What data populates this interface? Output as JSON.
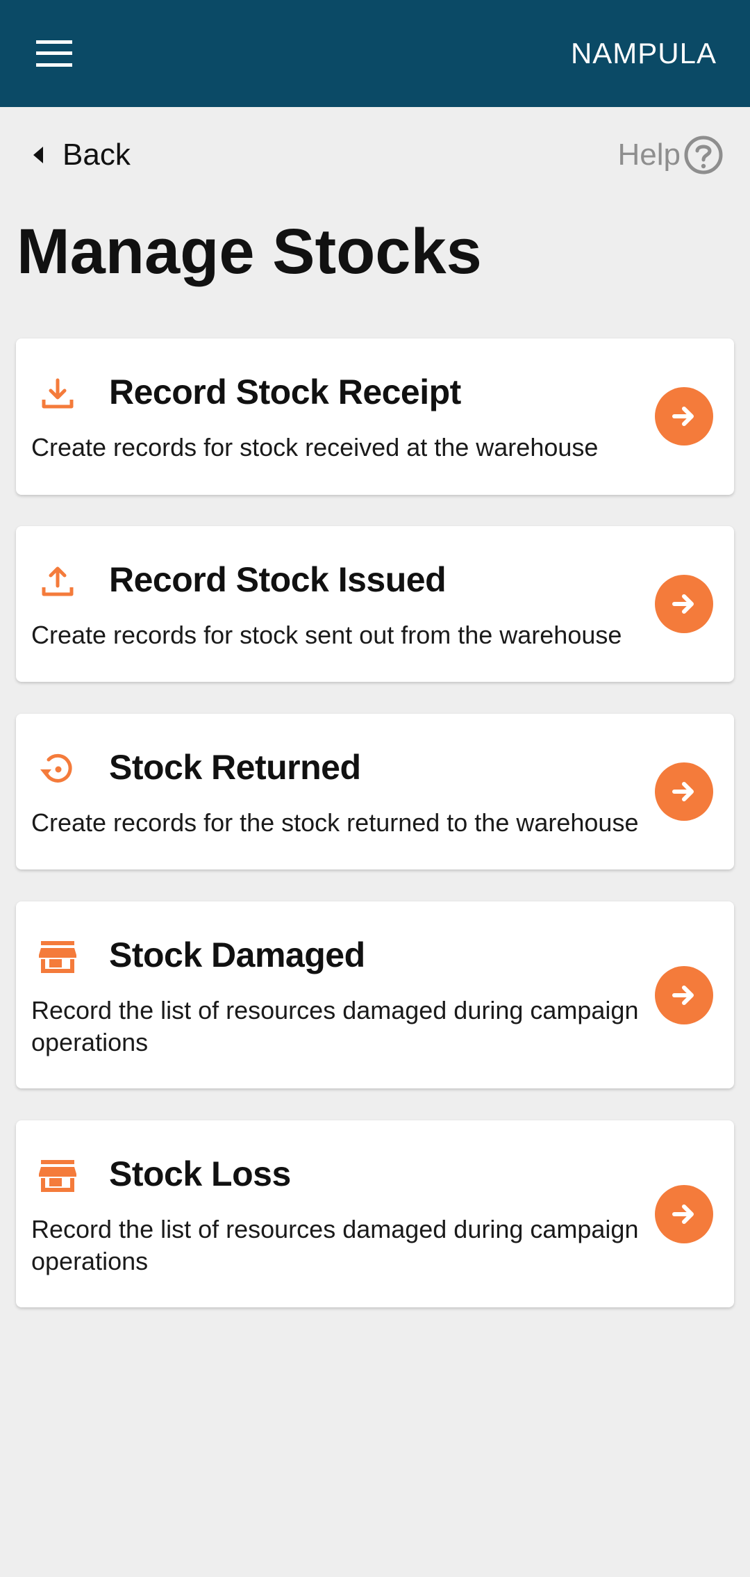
{
  "header": {
    "location": "NAMPULA",
    "menu_icon": "hamburger-menu-icon"
  },
  "nav": {
    "back_label": "Back",
    "help_label": "Help"
  },
  "page": {
    "title": "Manage Stocks"
  },
  "colors": {
    "header_bg": "#0b4a66",
    "accent": "#f47b3b",
    "background": "#eeeeee"
  },
  "cards": [
    {
      "title": "Record Stock Receipt",
      "description": "Create records for stock received at the warehouse",
      "icon": "download-icon"
    },
    {
      "title": "Record Stock Issued",
      "description": "Create records for stock sent out from the warehouse",
      "icon": "upload-icon"
    },
    {
      "title": "Stock Returned",
      "description": "Create records for the stock returned to the warehouse",
      "icon": "restore-icon"
    },
    {
      "title": "Stock Damaged",
      "description": "Record the list of resources damaged during campaign operations",
      "icon": "store-icon"
    },
    {
      "title": "Stock Loss",
      "description": "Record the list of resources damaged during campaign operations",
      "icon": "store-icon"
    }
  ]
}
